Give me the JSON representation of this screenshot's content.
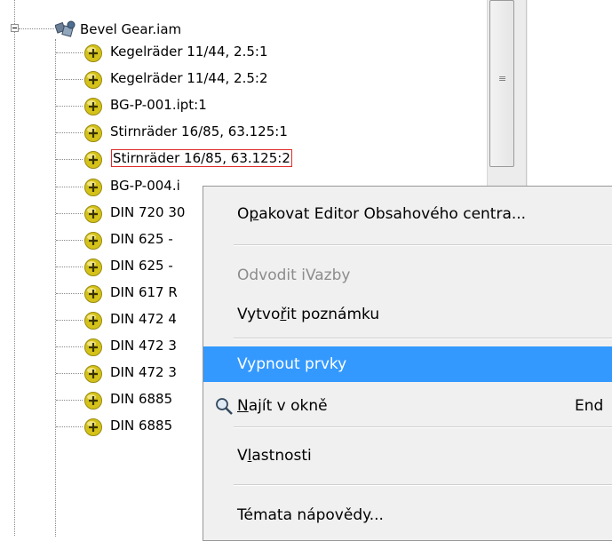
{
  "tree": {
    "root": {
      "label": "Bevel Gear.iam",
      "icon": "assembly-icon"
    },
    "items": [
      {
        "label": "Kegelräder 11/44, 2.5:1",
        "icon": "component-icon"
      },
      {
        "label": "Kegelräder 11/44, 2.5:2",
        "icon": "component-icon"
      },
      {
        "label": "BG-P-001.ipt:1",
        "icon": "component-icon"
      },
      {
        "label": "Stirnräder 16/85, 63.125:1",
        "icon": "component-icon"
      },
      {
        "label": "Stirnräder 16/85, 63.125:2",
        "icon": "component-icon",
        "selected": true
      },
      {
        "label": "BG-P-004.i",
        "icon": "component-icon"
      },
      {
        "label": "DIN 720 30",
        "icon": "component-icon"
      },
      {
        "label": "DIN 625 - ",
        "icon": "component-icon"
      },
      {
        "label": "DIN 625 - ",
        "icon": "component-icon"
      },
      {
        "label": "DIN 617 R",
        "icon": "component-icon"
      },
      {
        "label": "DIN 472 4",
        "icon": "component-icon"
      },
      {
        "label": "DIN 472 3",
        "icon": "component-icon"
      },
      {
        "label": "DIN 472 3",
        "icon": "component-icon"
      },
      {
        "label": "DIN 6885",
        "icon": "component-icon"
      },
      {
        "label": "DIN 6885",
        "icon": "component-icon"
      }
    ]
  },
  "context_menu": {
    "items": [
      {
        "label_pre": "O",
        "label_u": "p",
        "label_post": "akovat Editor Obsahového centra...",
        "state": "normal"
      },
      {
        "label_pre": "Odvodit iVazby",
        "label_u": "",
        "label_post": "",
        "state": "disabled"
      },
      {
        "label_pre": "Vytvo",
        "label_u": "ř",
        "label_post": "it poznámku",
        "state": "normal"
      },
      {
        "label_pre": "Vypnout prvky",
        "label_u": "",
        "label_post": "",
        "state": "hover"
      },
      {
        "label_pre": "",
        "label_u": "N",
        "label_post": "ajít v okně",
        "state": "normal",
        "icon": "find-in-window-icon",
        "shortcut": "End"
      },
      {
        "label_pre": "V",
        "label_u": "l",
        "label_post": "astnosti",
        "state": "normal"
      },
      {
        "label_pre": "Témata nápovědy...",
        "label_u": "",
        "label_post": "",
        "state": "normal"
      }
    ]
  },
  "colors": {
    "selection_outline": "#e02b2b",
    "menu_hover": "#3399ff",
    "menu_background": "#f0f0f0",
    "component_icon": "#d4c21a"
  }
}
